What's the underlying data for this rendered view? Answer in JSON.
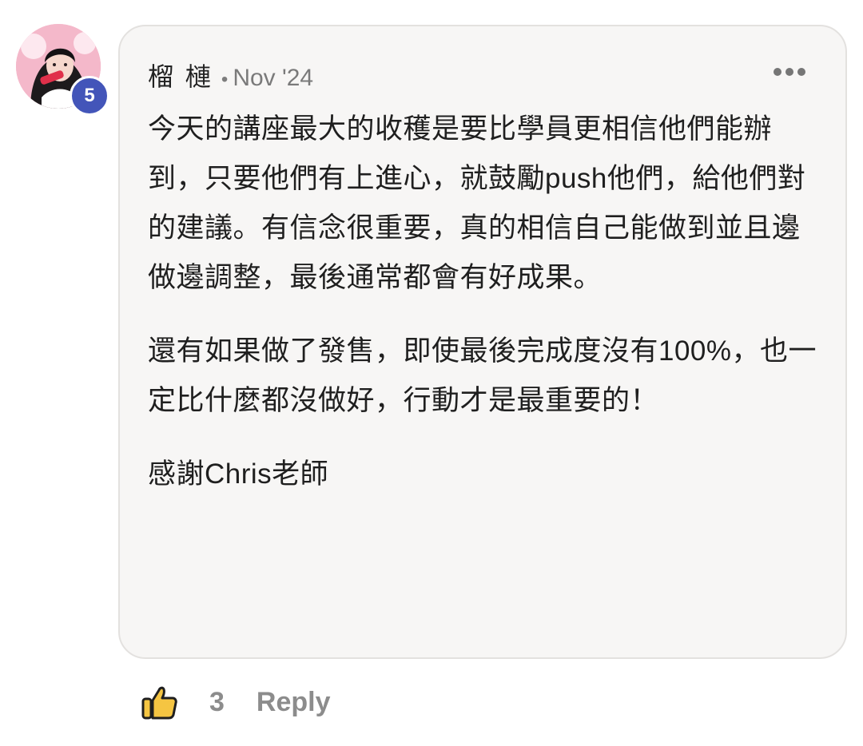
{
  "comment": {
    "author": "榴 槤",
    "separator": "•",
    "timestamp": "Nov '24",
    "level_badge": "5",
    "paragraphs": [
      "今天的講座最大的收穫是要比學員更相信他們能辦到，只要他們有上進心，就鼓勵push他們，給他們對的建議。有信念很重要，真的相信自己能做到並且邊做邊調整，最後通常都會有好成果。",
      "還有如果做了發售，即使最後完成度沒有100%，也一定比什麼都沒做好，行動才是最重要的！",
      "感謝Chris老師"
    ],
    "icons": {
      "more": "more-horizontal-icon",
      "like": "thumbs-up-icon"
    }
  },
  "actions": {
    "like_count": "3",
    "reply_label": "Reply"
  },
  "colors": {
    "card_background": "#f7f6f5",
    "card_border": "#e3e1df",
    "badge": "#4355b9",
    "muted_text": "#8c8c8c",
    "like_icon_fill": "#f5c542"
  }
}
